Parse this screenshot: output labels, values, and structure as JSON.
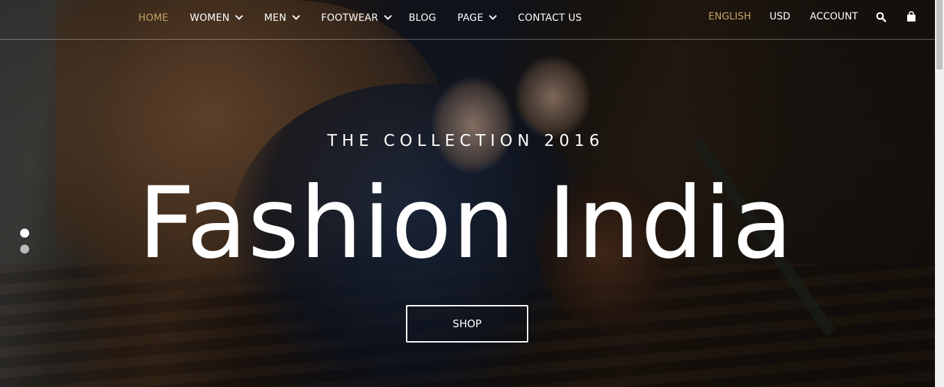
{
  "nav": {
    "items": [
      {
        "label": "HOME",
        "active": true,
        "dropdown": false
      },
      {
        "label": "WOMEN",
        "active": false,
        "dropdown": true
      },
      {
        "label": "MEN",
        "active": false,
        "dropdown": true
      },
      {
        "label": "FOOTWEAR",
        "active": false,
        "dropdown": true
      },
      {
        "label": "BLOG",
        "active": false,
        "dropdown": false
      },
      {
        "label": "PAGE",
        "active": false,
        "dropdown": true
      },
      {
        "label": "CONTACT US",
        "active": false,
        "dropdown": false
      }
    ],
    "language": "ENGLISH",
    "currency": "USD",
    "account": "ACCOUNT",
    "icons": [
      "search-icon",
      "shopping-bag-icon"
    ]
  },
  "hero": {
    "subtitle": "THE COLLECTION 2016",
    "title": "Fashion India",
    "cta_label": "SHOP"
  },
  "slider": {
    "slide_count": 2,
    "active_index": 0
  },
  "colors": {
    "accent": "#c4a467",
    "text": "#ffffff",
    "inactive_dot": "#b8b8b8"
  }
}
